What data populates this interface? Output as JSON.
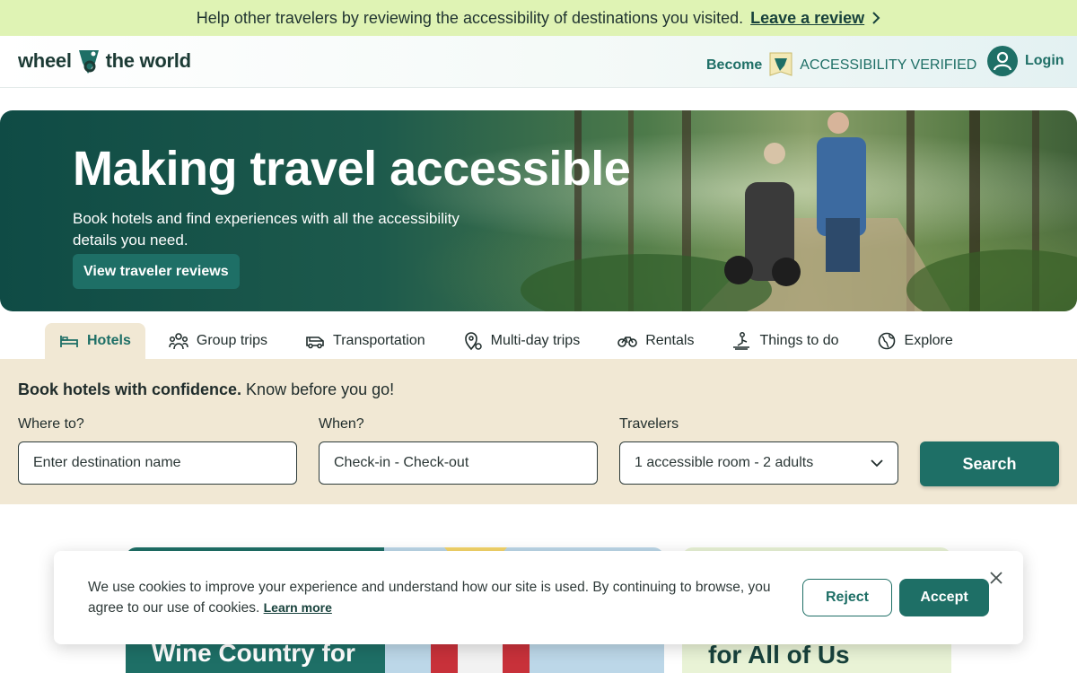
{
  "banner": {
    "message": "Help other travelers by reviewing the accessibility of destinations you visited.",
    "link": "Leave a review"
  },
  "header": {
    "logo_left": "wheel",
    "logo_right": "the world",
    "become": "Become",
    "accessibility_verified": "ACCESSIBILITY VERIFIED",
    "login": "Login"
  },
  "hero": {
    "title": "Making travel accessible",
    "subtitle": "Book hotels and find experiences with all the accessibility details you need.",
    "cta": "View traveler reviews"
  },
  "tabs": [
    {
      "label": "Hotels",
      "icon": "bed-icon",
      "active": true
    },
    {
      "label": "Group trips",
      "icon": "group-icon"
    },
    {
      "label": "Transportation",
      "icon": "van-icon"
    },
    {
      "label": "Multi-day trips",
      "icon": "map-pin-icon"
    },
    {
      "label": "Rentals",
      "icon": "bike-icon"
    },
    {
      "label": "Things to do",
      "icon": "activity-icon"
    },
    {
      "label": "Explore",
      "icon": "globe-icon"
    }
  ],
  "search": {
    "headline_bold": "Book hotels with confidence.",
    "headline_rest": "Know before you go!",
    "where_label": "Where to?",
    "where_placeholder": "Enter destination name",
    "when_label": "When?",
    "when_placeholder": "Check-in - Check-out",
    "travelers_label": "Travelers",
    "travelers_value": "1 accessible room - 2 adults",
    "button": "Search"
  },
  "cards": [
    {
      "title": "Wine Country for"
    },
    {
      "title": "for All of Us"
    }
  ],
  "cookie": {
    "text": "We use cookies to improve your experience and understand how our site is used. By continuing to browse, you agree to our use of cookies.",
    "learn_more": "Learn more",
    "reject": "Reject",
    "accept": "Accept"
  },
  "colors": {
    "brand_teal": "#1e6f66",
    "banner_green": "#dff3b4",
    "panel_beige": "#f1e8d4",
    "dark_text": "#1f2c2b"
  }
}
